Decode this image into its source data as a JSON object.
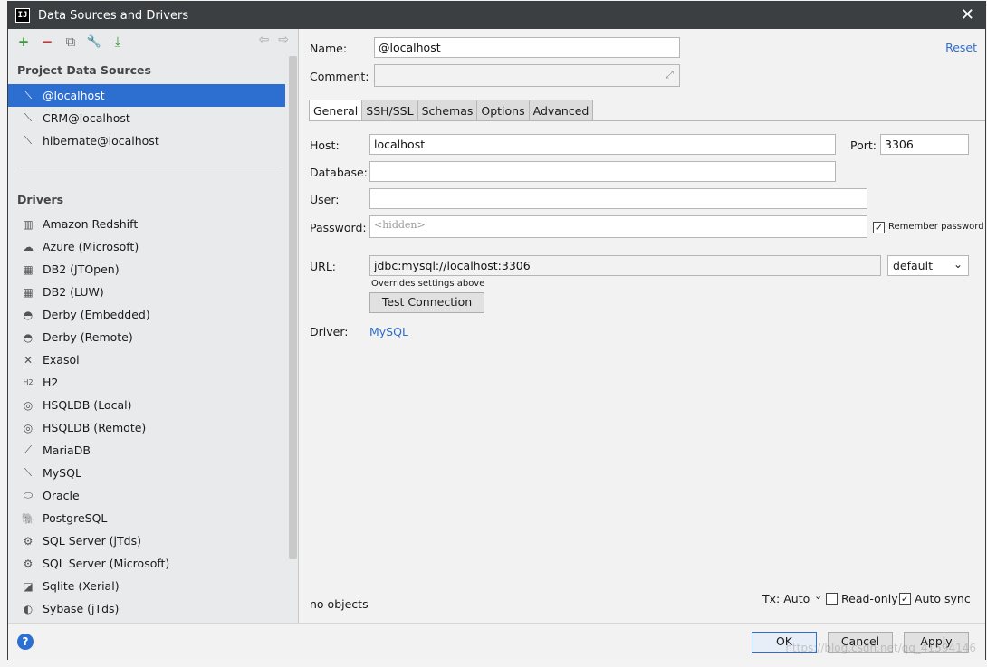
{
  "window": {
    "title": "Data Sources and Drivers",
    "app_icon_text": "IJ"
  },
  "toolbar": {
    "add": "+",
    "remove": "−",
    "duplicate": "⧉",
    "wrench": "🔧",
    "import": "⤓",
    "back": "⇦",
    "forward": "⇨"
  },
  "left": {
    "project_header": "Project Data Sources",
    "project_sources": [
      {
        "label": "@localhost",
        "icon": "mysql-dolphin-icon",
        "selected": true
      },
      {
        "label": "CRM@localhost",
        "icon": "mysql-dolphin-icon"
      },
      {
        "label": "hibernate@localhost",
        "icon": "mysql-dolphin-icon"
      }
    ],
    "drivers_header": "Drivers",
    "drivers": [
      {
        "label": "Amazon Redshift",
        "glyph": "▥"
      },
      {
        "label": "Azure (Microsoft)",
        "glyph": "☁"
      },
      {
        "label": "DB2 (JTOpen)",
        "glyph": "▦"
      },
      {
        "label": "DB2 (LUW)",
        "glyph": "▦"
      },
      {
        "label": "Derby (Embedded)",
        "glyph": "◓"
      },
      {
        "label": "Derby (Remote)",
        "glyph": "◓"
      },
      {
        "label": "Exasol",
        "glyph": "✕"
      },
      {
        "label": "H2",
        "glyph": "H2"
      },
      {
        "label": "HSQLDB (Local)",
        "glyph": "◎"
      },
      {
        "label": "HSQLDB (Remote)",
        "glyph": "◎"
      },
      {
        "label": "MariaDB",
        "glyph": "⟋"
      },
      {
        "label": "MySQL",
        "glyph": "⟍"
      },
      {
        "label": "Oracle",
        "glyph": "⬭"
      },
      {
        "label": "PostgreSQL",
        "glyph": "🐘"
      },
      {
        "label": "SQL Server (jTds)",
        "glyph": "⚙"
      },
      {
        "label": "SQL Server (Microsoft)",
        "glyph": "⚙"
      },
      {
        "label": "Sqlite (Xerial)",
        "glyph": "◪"
      },
      {
        "label": "Sybase (jTds)",
        "glyph": "◐"
      }
    ]
  },
  "form": {
    "name_label": "Name:",
    "name_value": "@localhost",
    "comment_label": "Comment:",
    "comment_value": "",
    "reset": "Reset",
    "tabs": [
      "General",
      "SSH/SSL",
      "Schemas",
      "Options",
      "Advanced"
    ],
    "host_label": "Host:",
    "host_value": "localhost",
    "port_label": "Port:",
    "port_value": "3306",
    "database_label": "Database:",
    "database_value": "",
    "user_label": "User:",
    "user_value": "",
    "password_label": "Password:",
    "password_placeholder": "<hidden>",
    "remember_password": "Remember password",
    "url_label": "URL:",
    "url_value": "jdbc:mysql://localhost:3306",
    "url_mode": "default",
    "overrides_note": "Overrides settings above",
    "test_connection": "Test Connection",
    "driver_label": "Driver:",
    "driver_value": "MySQL",
    "no_objects": "no objects",
    "tx_label": "Tx: Auto",
    "read_only": "Read-only",
    "auto_sync": "Auto sync"
  },
  "buttons": {
    "ok": "OK",
    "cancel": "Cancel",
    "apply": "Apply",
    "help": "?"
  },
  "watermark": "https://blog.csdn.net/qq_41594146",
  "colors": {
    "accent": "#2d6ed1",
    "title_bar": "#3c3f41"
  }
}
